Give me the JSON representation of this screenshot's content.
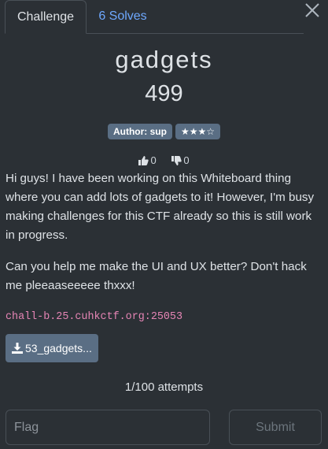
{
  "tabs": [
    {
      "label": "Challenge",
      "active": true
    },
    {
      "label": "6 Solves",
      "active": false
    }
  ],
  "challenge": {
    "name": "gadgets",
    "points": "499",
    "author_badge": "Author: sup",
    "difficulty_badge": "★★★☆",
    "likes": "0",
    "dislikes": "0",
    "description": [
      "Hi guys! I have been working on this Whiteboard thing where you can add lots of gadgets to it! However, I'm busy making challenges for this CTF already so this is still work in progress.",
      "Can you help me make the UI and UX better? Don't hack me pleeaaseeeee thxxx!"
    ],
    "connection": "chall-b.25.cuhkctf.org:25053",
    "file_label": "53_gadgets...",
    "attempts": "1/100 attempts"
  },
  "form": {
    "flag_placeholder": "Flag",
    "flag_value": "",
    "submit_label": "Submit"
  },
  "colors": {
    "background": "#2b3035",
    "link": "#6ea8fe",
    "badge": "#5a6e84",
    "code": "#e685b5"
  },
  "icons": [
    "close-icon",
    "thumbs-up-icon",
    "thumbs-down-icon",
    "download-icon"
  ]
}
